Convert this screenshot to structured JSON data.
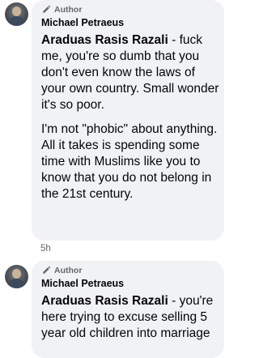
{
  "comments": [
    {
      "author_badge": "Author",
      "name": "Michael Petraeus",
      "mention": "Araduas Rasis Razali",
      "paragraph1_rest": " - fuck me, you're so dumb that you don't even know the laws of your own country. Small wonder it's so poor.",
      "paragraph2": "I'm not \"phobic\" about anything. All it takes is spending some time with Muslims like you to know that you do not belong in the 21st century.",
      "time": "5h"
    },
    {
      "author_badge": "Author",
      "name": "Michael Petraeus",
      "mention": "Araduas Rasis Razali",
      "paragraph1_rest": " - you're here trying to excuse selling 5 year old children into marriage"
    }
  ],
  "colors": {
    "bubble": "#f0f2f5",
    "text": "#050505",
    "secondary": "#65676b"
  },
  "icons": [
    "pencil-icon",
    "avatar"
  ]
}
